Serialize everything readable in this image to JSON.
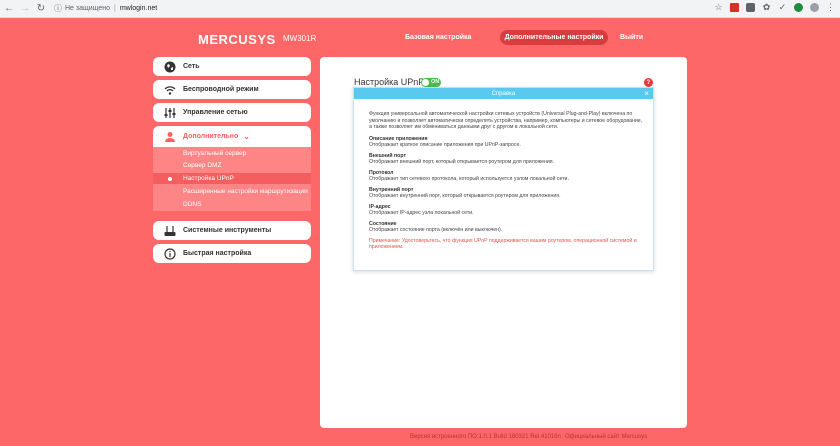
{
  "browser": {
    "security_text": "Не защищено",
    "separator": "|",
    "url": "mwlogin.net",
    "back_icon": "arrow-left-icon",
    "forward_icon": "arrow-right-icon",
    "reload_icon": "reload-icon",
    "info_icon": "info-icon"
  },
  "header": {
    "brand": "MERCUSYS",
    "model": "MW301R",
    "nav": {
      "basic": "Базовая настройка",
      "advanced": "Дополнительные настройки",
      "exit": "Выйти"
    }
  },
  "sidebar": {
    "items": [
      {
        "label": "Сеть",
        "icon": "globe-icon"
      },
      {
        "label": "Беспроводной режим",
        "icon": "wifi-icon"
      },
      {
        "label": "Управление сетью",
        "icon": "sliders-icon"
      },
      {
        "label": "Дополнительно",
        "icon": "user-icon"
      },
      {
        "label": "Системные инструменты",
        "icon": "router-icon"
      },
      {
        "label": "Быстрая настройка",
        "icon": "info-icon"
      }
    ],
    "submenu": [
      "Виртуальный сервер",
      "Сервер DMZ",
      "Настройка UPnP",
      "Расширенные настройки маршрутизации",
      "DDNS"
    ]
  },
  "main": {
    "title": "Настройка UPnP",
    "toggle_label": "ON",
    "help_icon_glyph": "?"
  },
  "dialog": {
    "title": "Справка",
    "close": "×",
    "intro": "Функция универсальной автоматической настройки сетевых устройств (Universal Plug-and-Play) включена по умолчанию и позволяет автоматически определять устройства, например, компьютеры и сетевое оборудование, а также позволяет им обмениваться данными друг с другом в локальной сети.",
    "terms": [
      {
        "term": "Описание приложения",
        "desc": "Отображает краткое описание приложения при UPnP-запросе."
      },
      {
        "term": "Внешний порт",
        "desc": "Отображает внешний порт, который открывается роутером для приложения."
      },
      {
        "term": "Протокол",
        "desc": "Отображает тип сетевого протокола, который используется узлом локальной сети."
      },
      {
        "term": "Внутренний порт",
        "desc": "Отображает внутренний порт, который открывается роутером для приложения."
      },
      {
        "term": "IP-адрес",
        "desc": "Отображает IP-адрес узла локальной сети."
      },
      {
        "term": "Состояние",
        "desc": "Отображает состояние порта (включён или выключен)."
      }
    ],
    "note": "Примечание: Удостоверьтесь, что функция UPnP поддерживается вашим роутером, операционной системой и приложением."
  },
  "footer": {
    "version": "Версия встроенного ПО:1.0.1 Build 180321 Rel.41016n",
    "site": "Официальный сайт Mercusys"
  },
  "colors": {
    "background": "#fe6768",
    "accent_dark": "#d83c3d",
    "toggle_on": "#4cbb4c",
    "dialog_header": "#59c9f0"
  }
}
